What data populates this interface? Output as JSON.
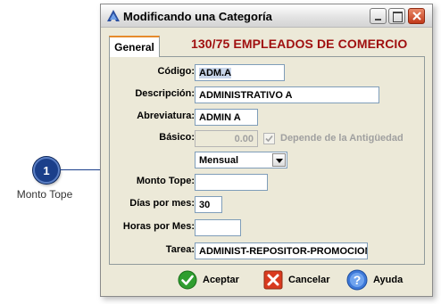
{
  "callout": {
    "number": "1",
    "caption": "Monto Tope"
  },
  "window": {
    "title": "Modificando una Categoría"
  },
  "tabs": [
    {
      "label": "General"
    }
  ],
  "header": {
    "text": "130/75 EMPLEADOS DE COMERCIO"
  },
  "form": {
    "codigo": {
      "label": "Código:",
      "value": "ADM.A"
    },
    "descripcion": {
      "label": "Descripción:",
      "value": "ADMINISTRATIVO A"
    },
    "abreviatura": {
      "label": "Abreviatura:",
      "value": "ADMIN A"
    },
    "basico": {
      "label": "Básico:",
      "value": "0.00"
    },
    "depende": {
      "label": "Depende de la Antigüedad",
      "checked": true
    },
    "periodo": {
      "value": "Mensual"
    },
    "monto_tope": {
      "label": "Monto Tope:",
      "value": ""
    },
    "dias_por_mes": {
      "label": "Días por mes:",
      "value": "30"
    },
    "horas_por_mes": {
      "label": "Horas por Mes:",
      "value": ""
    },
    "tarea": {
      "label": "Tarea:",
      "value": "ADMINIST-REPOSITOR-PROMOCION"
    }
  },
  "buttons": {
    "aceptar": "Aceptar",
    "cancelar": "Cancelar",
    "ayuda": "Ayuda"
  },
  "colors": {
    "header_text": "#a01010",
    "accent": "#1b3f8a"
  }
}
